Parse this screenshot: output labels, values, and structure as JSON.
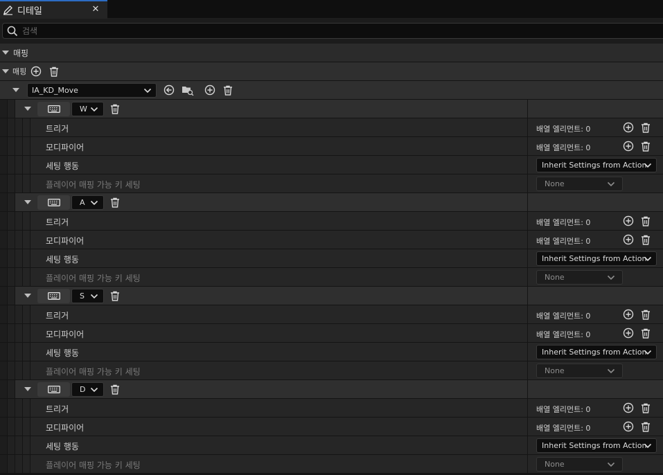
{
  "tab": {
    "title": "디테일",
    "close": "✕"
  },
  "search": {
    "placeholder": "검색",
    "value": ""
  },
  "category": {
    "label": "매핑"
  },
  "mappings_header": {
    "label": "매핑"
  },
  "action": {
    "name": "IA_KD_Move"
  },
  "labels": {
    "triggers": "트리거",
    "modifiers": "모디파이어",
    "settings_behavior": "세팅 행동",
    "player_mappable": "플레이어 매핑 가능 키 세팅",
    "array_elements": "배열 엘리먼트: 0",
    "inherit": "Inherit Settings from Action",
    "none": "None"
  },
  "keys": [
    {
      "key": "W"
    },
    {
      "key": "A"
    },
    {
      "key": "S"
    },
    {
      "key": "D"
    }
  ],
  "colors": {
    "accent": "#2d6cc4",
    "panel": "#262626",
    "background": "#151515"
  },
  "icons": [
    "edit-icon",
    "close-icon",
    "search-icon",
    "chevron-down-icon",
    "add-icon",
    "delete-icon",
    "keyboard-icon",
    "back-arrow-icon",
    "browse-folder-icon"
  ]
}
